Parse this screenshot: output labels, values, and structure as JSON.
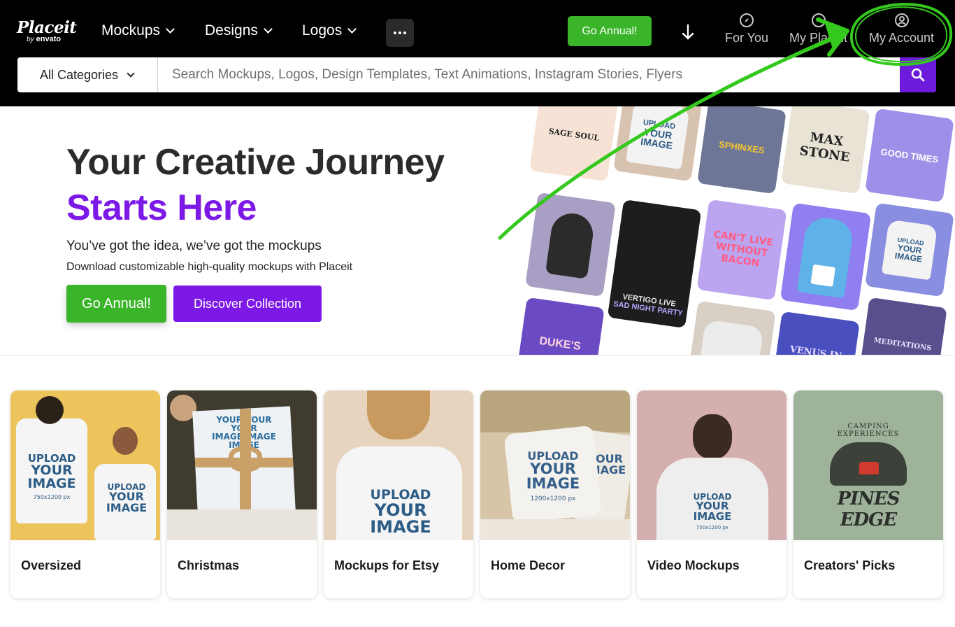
{
  "header": {
    "logo_main": "Placeit",
    "logo_by": "by",
    "logo_brand": "envato",
    "nav": [
      {
        "label": "Mockups"
      },
      {
        "label": "Designs"
      },
      {
        "label": "Logos"
      }
    ],
    "go_annual": "Go Annual!",
    "links": {
      "for_you": "For You",
      "my_placeit": "My Placeit",
      "my_account": "My Account"
    },
    "category_select": "All Categories",
    "search_placeholder": "Search Mockups, Logos, Design Templates, Text Animations, Instagram Stories, Flyers"
  },
  "hero": {
    "title_line1": "Your Creative Journey",
    "title_line2": "Starts Here",
    "subtitle": "You’ve got the idea, we’ve got the mockups",
    "description": "Download customizable high-quality mockups with Placeit",
    "go_annual": "Go Annual!",
    "discover": "Discover Collection",
    "collage_texts": [
      "SAGE SOUL",
      "MAX STONE",
      "SPHINXES",
      "GOOD TIMES",
      "CAN'T LIVE WITHOUT BACON",
      "VERTIGO LIVE",
      "SAD NIGHT PARTY",
      "DUKE'S",
      "VENUS IN LIBRO",
      "MEDITATIONS",
      "UPLOAD YOUR IMAGE",
      "750x1200 px"
    ]
  },
  "cards": [
    {
      "label": "Oversized"
    },
    {
      "label": "Christmas"
    },
    {
      "label": "Mockups for Etsy"
    },
    {
      "label": "Home Decor"
    },
    {
      "label": "Video Mockups"
    },
    {
      "label": "Creators' Picks"
    }
  ],
  "card_art": {
    "upload": "UPLOAD",
    "your": "YOUR",
    "image": "IMAGE",
    "size": "750x1200 px",
    "size_small": "1200x1200 px",
    "camping": "CAMPING EXPERIENCES",
    "pines": "PINES EDGE"
  },
  "colors": {
    "brand_purple": "#7d19e6",
    "brand_green": "#3ab52a",
    "annotation_green": "#35c91e"
  }
}
